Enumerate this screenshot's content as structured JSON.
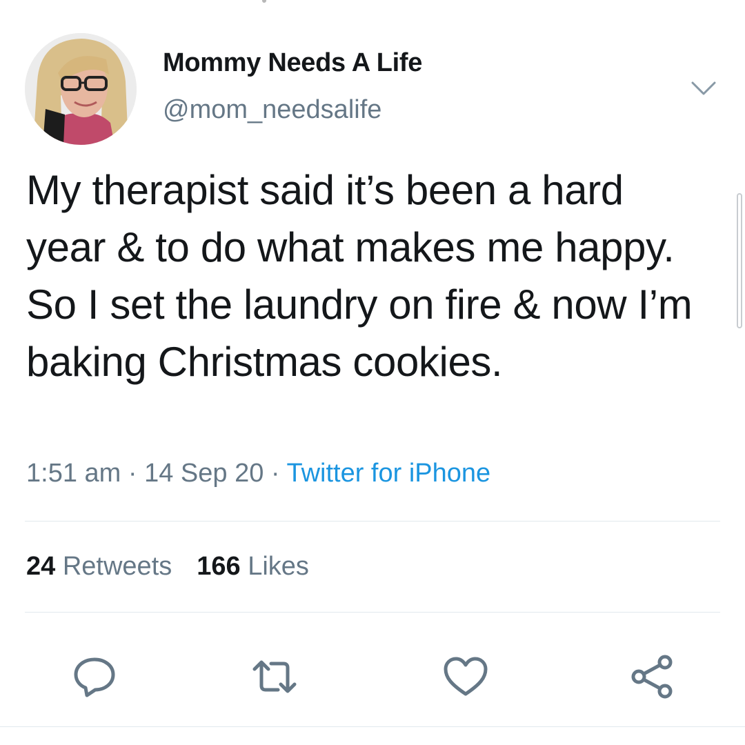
{
  "tweet": {
    "display_name": "Mommy Needs A Life",
    "handle": "@mom_needsalife",
    "text": "My therapist said it’s been a hard year & to do what makes me happy. So I set the laundry on fire & now I’m baking Christmas cookies.",
    "time": "1:51 am",
    "date": "14 Sep 20",
    "separator": "·",
    "source": "Twitter for iPhone"
  },
  "stats": {
    "retweets": {
      "count": "24",
      "label": "Retweets"
    },
    "likes": {
      "count": "166",
      "label": "Likes"
    }
  },
  "icons": {
    "caret": "chevron-down-icon",
    "reply": "reply-icon",
    "retweet": "retweet-icon",
    "like": "heart-icon",
    "share": "share-icon"
  },
  "colors": {
    "text": "#14171a",
    "secondary": "#657786",
    "link": "#1b95e0",
    "divider": "#e1e8ed",
    "icon": "#657786"
  }
}
